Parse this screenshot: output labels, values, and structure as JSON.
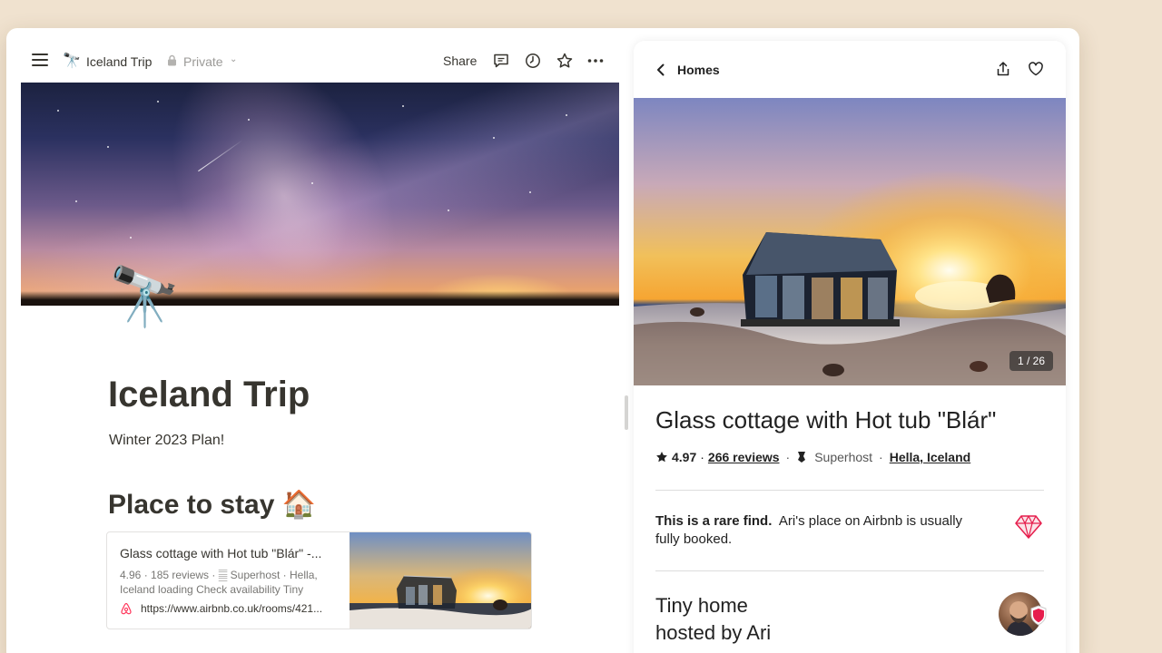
{
  "notion": {
    "topbar": {
      "page_emoji": "🔭",
      "page_name": "Iceland Trip",
      "privacy": "Private",
      "share_label": "Share"
    },
    "page": {
      "icon": "🔭",
      "title": "Iceland Trip",
      "subtitle": "Winter 2023 Plan!",
      "heading": "Place to stay 🏠"
    },
    "bookmark": {
      "title": "Glass cottage with Hot tub \"Blár\" -...",
      "description": "4.96 · 185 reviews · 𝄛 Superhost · Hella, Iceland loading Check availability Tiny",
      "url": "https://www.airbnb.co.uk/rooms/421..."
    }
  },
  "airbnb": {
    "back_label": "Homes",
    "photo_counter": "1 / 26",
    "listing_title": "Glass cottage with Hot tub \"Blár\"",
    "rating": "4.97",
    "reviews": "266 reviews",
    "host_status": "Superhost",
    "location": "Hella, Iceland",
    "rare_find_bold": "This is a rare find.",
    "rare_find_text": "Ari's place on Airbnb is usually fully booked.",
    "host_line1": "Tiny home",
    "host_line2": "hosted by Ari",
    "accent": "#e61e4d"
  }
}
